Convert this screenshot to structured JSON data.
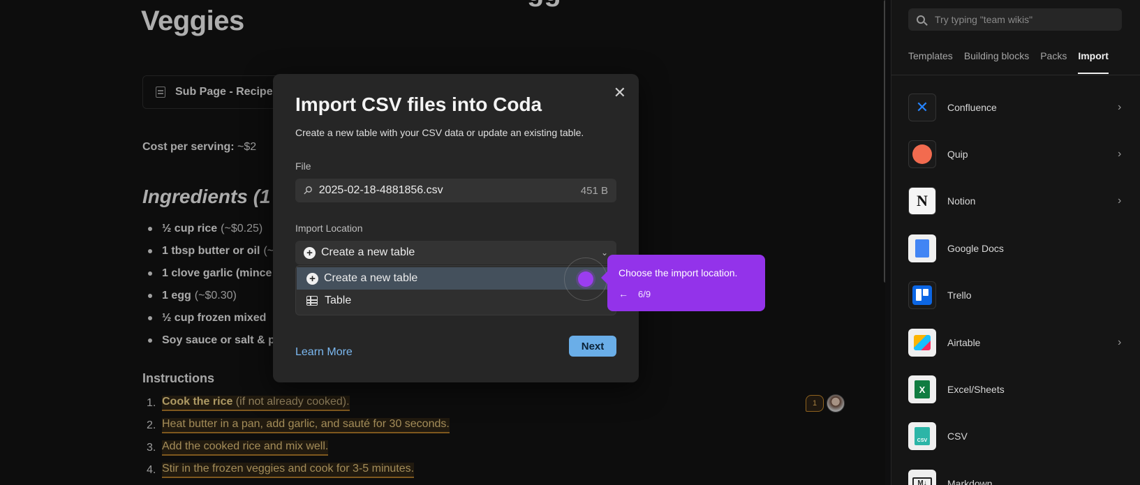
{
  "document": {
    "title": "Veggies",
    "title_top_fragment": "gg",
    "subpage_label": "Sub Page - Recipe",
    "cost_label": "Cost per serving:",
    "cost_value": " ~$2",
    "ingredients_heading": "Ingredients (1",
    "ingredients": [
      {
        "bold": "½ cup rice",
        "rest": "(~$0.25)"
      },
      {
        "bold": "1 tbsp butter or oil",
        "rest": "(~"
      },
      {
        "bold": "1 clove garlic (mince",
        "rest": ""
      },
      {
        "bold": "1 egg",
        "rest": "(~$0.30)"
      },
      {
        "bold": "½ cup frozen mixed",
        "rest": ""
      },
      {
        "bold": "Soy sauce or salt & p",
        "rest": ""
      }
    ],
    "instructions_heading": "Instructions",
    "steps": [
      {
        "num": "1.",
        "bold": "Cook the rice",
        "rest": " (if not already cooked)."
      },
      {
        "num": "2.",
        "bold": "",
        "rest": "Heat butter in a pan, add garlic, and sauté for 30 seconds."
      },
      {
        "num": "3.",
        "bold": "",
        "rest": "Add the cooked rice and mix well."
      },
      {
        "num": "4.",
        "bold": "",
        "rest": "Stir in the frozen veggies and cook for 3-5 minutes."
      }
    ],
    "comment_count": "1"
  },
  "modal": {
    "title": "Import CSV files into Coda",
    "subtitle": "Create a new table with your CSV data or update an existing table.",
    "file_label": "File",
    "file_name": "2025-02-18-4881856.csv",
    "file_size": "451 B",
    "location_label": "Import Location",
    "location_selected": "Create a new table",
    "options": [
      {
        "label": "Create a new table",
        "icon": "plus-circle-icon",
        "active": true
      },
      {
        "label": "Table",
        "icon": "table-icon",
        "active": false
      }
    ],
    "learn_more": "Learn More",
    "next": "Next",
    "close_glyph": "✕"
  },
  "tooltip": {
    "text": "Choose the import location.",
    "back_glyph": "←",
    "progress": "6/9"
  },
  "panel": {
    "search_placeholder": "Try typing \"team wikis\"",
    "tabs": [
      "Templates",
      "Building blocks",
      "Packs",
      "Import"
    ],
    "active_tab": "Import",
    "imports": [
      {
        "name": "Confluence",
        "icon": "confluence-logo-icon",
        "chevron": true
      },
      {
        "name": "Quip",
        "icon": "quip-logo-icon",
        "chevron": true
      },
      {
        "name": "Notion",
        "icon": "notion-logo-icon",
        "chevron": true
      },
      {
        "name": "Google Docs",
        "icon": "google-docs-logo-icon",
        "chevron": false
      },
      {
        "name": "Trello",
        "icon": "trello-logo-icon",
        "chevron": false
      },
      {
        "name": "Airtable",
        "icon": "airtable-logo-icon",
        "chevron": true
      },
      {
        "name": "Excel/Sheets",
        "icon": "excel-logo-icon",
        "chevron": false
      },
      {
        "name": "CSV",
        "icon": "csv-logo-icon",
        "chevron": false
      },
      {
        "name": "Markdown",
        "icon": "markdown-logo-icon",
        "chevron": false
      }
    ]
  },
  "colors": {
    "accent_purple": "#9333ea",
    "link_blue": "#7bb8f0",
    "button_blue": "#6aaee8",
    "highlight_orange": "#b07a2a"
  }
}
